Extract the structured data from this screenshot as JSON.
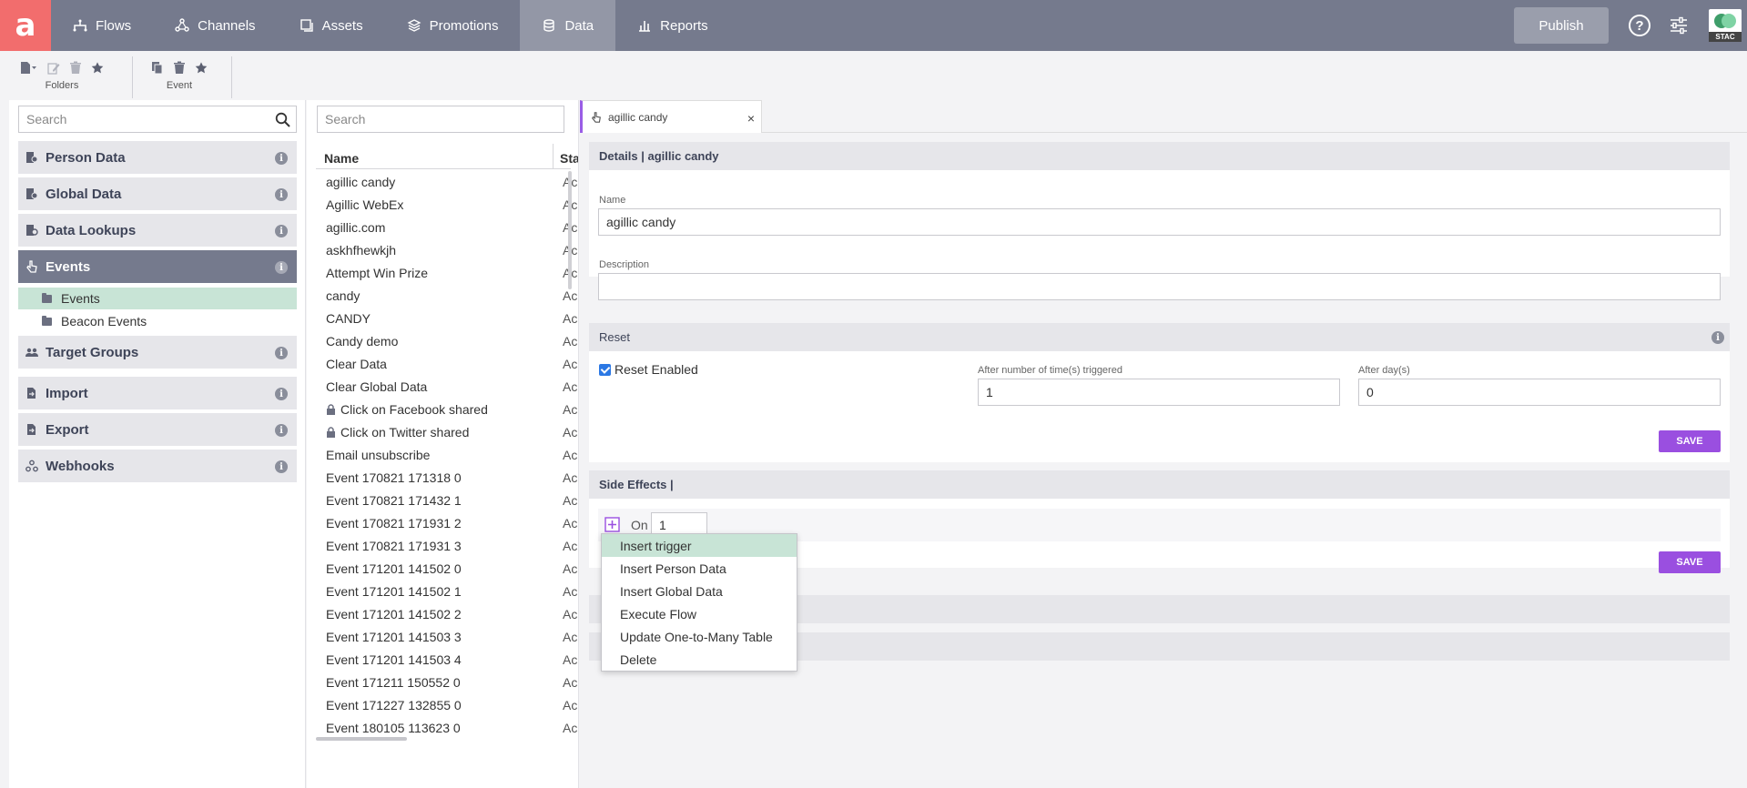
{
  "app": {
    "logo_letter": "a"
  },
  "nav": {
    "items": [
      {
        "label": "Flows",
        "icon": "flows-icon"
      },
      {
        "label": "Channels",
        "icon": "channels-icon"
      },
      {
        "label": "Assets",
        "icon": "assets-icon"
      },
      {
        "label": "Promotions",
        "icon": "promotions-icon"
      },
      {
        "label": "Data",
        "icon": "data-icon",
        "active": true
      },
      {
        "label": "Reports",
        "icon": "reports-icon"
      }
    ],
    "publish_label": "Publish",
    "help_label": "?",
    "badge_label": "STAC"
  },
  "toolbar": {
    "folders_label": "Folders",
    "event_label": "Event"
  },
  "left": {
    "search_placeholder": "Search",
    "sections": [
      {
        "label": "Person Data",
        "icon": "person-data-icon"
      },
      {
        "label": "Global Data",
        "icon": "global-data-icon"
      },
      {
        "label": "Data Lookups",
        "icon": "data-lookups-icon"
      },
      {
        "label": "Events",
        "icon": "events-icon",
        "active": true
      },
      {
        "label": "Target Groups",
        "icon": "target-groups-icon"
      },
      {
        "label": "Import",
        "icon": "import-icon"
      },
      {
        "label": "Export",
        "icon": "export-icon"
      },
      {
        "label": "Webhooks",
        "icon": "webhooks-icon"
      }
    ],
    "subitems": [
      {
        "label": "Events",
        "selected": true
      },
      {
        "label": "Beacon Events"
      }
    ]
  },
  "list": {
    "search_placeholder": "Search",
    "col_name": "Name",
    "col_status": "Sta",
    "rows": [
      {
        "name": "agillic candy",
        "status": "Ac"
      },
      {
        "name": "Agillic WebEx",
        "status": "Ac"
      },
      {
        "name": "agillic.com",
        "status": "Ac"
      },
      {
        "name": "askhfhewkjh",
        "status": "Ac"
      },
      {
        "name": "Attempt Win Prize",
        "status": "Ac"
      },
      {
        "name": "candy",
        "status": "Ac"
      },
      {
        "name": "CANDY",
        "status": "Ac"
      },
      {
        "name": "Candy demo",
        "status": "Ac"
      },
      {
        "name": "Clear Data",
        "status": "Ac"
      },
      {
        "name": "Clear Global Data",
        "status": "Ac"
      },
      {
        "name": "Click on Facebook shared",
        "status": "Ac",
        "locked": true
      },
      {
        "name": "Click on Twitter shared",
        "status": "Ac",
        "locked": true
      },
      {
        "name": "Email unsubscribe",
        "status": "Ac"
      },
      {
        "name": "Event 170821 171318 0",
        "status": "Ac"
      },
      {
        "name": "Event 170821 171432 1",
        "status": "Ac"
      },
      {
        "name": "Event 170821 171931 2",
        "status": "Ac"
      },
      {
        "name": "Event 170821 171931 3",
        "status": "Ac"
      },
      {
        "name": "Event 171201 141502 0",
        "status": "Ac"
      },
      {
        "name": "Event 171201 141502 1",
        "status": "Ac"
      },
      {
        "name": "Event 171201 141502 2",
        "status": "Ac"
      },
      {
        "name": "Event 171201 141503 3",
        "status": "Ac"
      },
      {
        "name": "Event 171201 141503 4",
        "status": "Ac"
      },
      {
        "name": "Event 171211 150552 0",
        "status": "Ac"
      },
      {
        "name": "Event 171227 132855 0",
        "status": "Ac"
      },
      {
        "name": "Event 180105 113623 0",
        "status": "Ac"
      }
    ]
  },
  "detail": {
    "tab_label": "agillic candy",
    "tab_close": "×",
    "details_header": "Details | agillic candy",
    "name_label": "Name",
    "name_value": "agillic candy",
    "description_label": "Description",
    "description_value": "",
    "reset_header": "Reset",
    "reset_enabled_label": "Reset Enabled",
    "reset_enabled": true,
    "triggered_label": "After number of time(s) triggered",
    "triggered_value": "1",
    "days_label": "After day(s)",
    "days_value": "0",
    "save_label": "SAVE",
    "side_effects_header": "Side Effects |",
    "on_label": "On",
    "on_value": "1",
    "save2_label": "SAVE"
  },
  "menu": {
    "items": [
      {
        "label": "Insert trigger",
        "highlighted": true
      },
      {
        "label": "Insert Person Data"
      },
      {
        "label": "Insert Global Data"
      },
      {
        "label": "Execute Flow"
      },
      {
        "label": "Update One-to-Many Table"
      },
      {
        "label": "Delete"
      }
    ]
  },
  "colors": {
    "nav_bg": "#757a8d",
    "logo_bg": "#f26d6d",
    "accent_purple": "#9a4fe0",
    "selection_green": "#c8e4d6"
  }
}
